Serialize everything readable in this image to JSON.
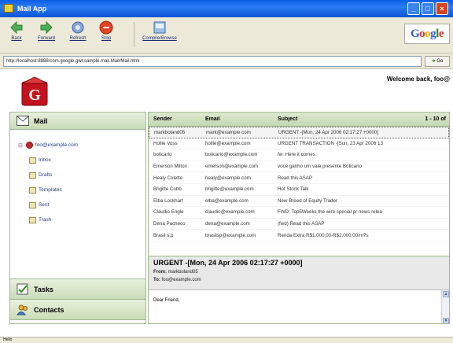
{
  "window": {
    "title": "Mail App"
  },
  "toolbar": {
    "back": "Back",
    "forward": "Forward",
    "refresh": "Refresh",
    "stop": "Stop",
    "compile": "Compile/Browse"
  },
  "google_logo": "Google",
  "address_bar": {
    "url": "http://localhost:8888/com.google.gwt.sample.mail.Mail/Mail.html",
    "go": "Go"
  },
  "header": {
    "welcome": "Welcome back, foo@"
  },
  "sidebar": {
    "mail_label": "Mail",
    "account": "foo@example.com",
    "folders": [
      "Inbox",
      "Drafts",
      "Templates",
      "Sent",
      "Trash"
    ],
    "tasks_label": "Tasks",
    "contacts_label": "Contacts"
  },
  "message_list": {
    "columns": [
      "Sender",
      "Email",
      "Subject"
    ],
    "count": "1 - 10 of",
    "rows": [
      {
        "sender": "markboland05",
        "email": "mark@example.com",
        "subject": "URGENT -[Mon, 24 Apr 2006 02:17:27 +0000]"
      },
      {
        "sender": "Hollie Voss",
        "email": "hollie@example.com",
        "subject": "URGENT TRANSACTION -[Sun, 23 Apr 2006 13"
      },
      {
        "sender": "boticario",
        "email": "boticario@example.com",
        "subject": "fw: Here it comes"
      },
      {
        "sender": "Emerson Milton",
        "email": "emerson@example.com",
        "subject": "voce ganho um vale presente Boticario"
      },
      {
        "sender": "Healy Colette",
        "email": "healy@example.com",
        "subject": "Read this ASAP"
      },
      {
        "sender": "Brigitte Cobb",
        "email": "brigitte@example.com",
        "subject": "Hot Stock Talk"
      },
      {
        "sender": "Elba Lockhart",
        "email": "elba@example.com",
        "subject": "New Breed of Equity Trader"
      },
      {
        "sender": "Claudio Engle",
        "email": "claudio@example.com",
        "subject": "FWD: Top5Weeks the wire special pr news relea"
      },
      {
        "sender": "Dena Pacheco",
        "email": "dena@example.com",
        "subject": "(fwd) Read this ASAP"
      },
      {
        "sender": "Brasil s.p",
        "email": "brasilsp@example.com",
        "subject": "Renda Extra R$1.000,00-R$2.000,00/m?s"
      }
    ]
  },
  "preview": {
    "subject": "URGENT -[Mon, 24 Apr 2006 02:17:27 +0000]",
    "from_label": "From:",
    "from": "markboland05",
    "to_label": "To:",
    "to": "foo@example.com",
    "body": "Dear Friend,"
  },
  "status": {
    "text": "Hello"
  }
}
